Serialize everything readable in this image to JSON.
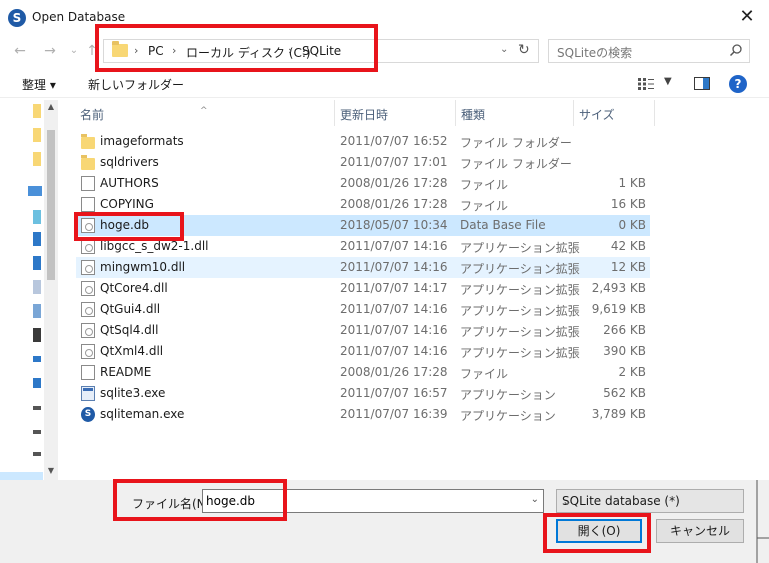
{
  "window": {
    "title": "Open Database",
    "app_icon_letter": "S",
    "close_glyph": "✕"
  },
  "address_bar": {
    "crumbs": [
      "PC",
      "ローカル ディスク (C:)",
      "SQLite"
    ],
    "separator": "›"
  },
  "search": {
    "placeholder": "SQLiteの検索",
    "icon": "search-icon"
  },
  "toolbar": {
    "organize_label": "整理 ▾",
    "new_folder_label": "新しいフォルダー"
  },
  "columns": {
    "name": "名前",
    "date": "更新日時",
    "type": "種類",
    "size": "サイズ"
  },
  "files": [
    {
      "name": "imageformats",
      "date": "2011/07/07 16:52",
      "type": "ファイル フォルダー",
      "size": "",
      "icon": "folder-icon"
    },
    {
      "name": "sqldrivers",
      "date": "2011/07/07 17:01",
      "type": "ファイル フォルダー",
      "size": "",
      "icon": "folder-icon"
    },
    {
      "name": "AUTHORS",
      "date": "2008/01/26 17:28",
      "type": "ファイル",
      "size": "1 KB",
      "icon": "file-icon"
    },
    {
      "name": "COPYING",
      "date": "2008/01/26 17:28",
      "type": "ファイル",
      "size": "16 KB",
      "icon": "file-icon"
    },
    {
      "name": "hoge.db",
      "date": "2018/05/07 10:34",
      "type": "Data Base File",
      "size": "0 KB",
      "icon": "db-file-icon",
      "state": "selected"
    },
    {
      "name": "libgcc_s_dw2-1.dll",
      "date": "2011/07/07 14:16",
      "type": "アプリケーション拡張",
      "size": "42 KB",
      "icon": "dll-icon"
    },
    {
      "name": "mingwm10.dll",
      "date": "2011/07/07 14:16",
      "type": "アプリケーション拡張",
      "size": "12 KB",
      "icon": "dll-icon",
      "state": "hover"
    },
    {
      "name": "QtCore4.dll",
      "date": "2011/07/07 14:17",
      "type": "アプリケーション拡張",
      "size": "2,493 KB",
      "icon": "dll-icon"
    },
    {
      "name": "QtGui4.dll",
      "date": "2011/07/07 14:16",
      "type": "アプリケーション拡張",
      "size": "9,619 KB",
      "icon": "dll-icon"
    },
    {
      "name": "QtSql4.dll",
      "date": "2011/07/07 14:16",
      "type": "アプリケーション拡張",
      "size": "266 KB",
      "icon": "dll-icon"
    },
    {
      "name": "QtXml4.dll",
      "date": "2011/07/07 14:16",
      "type": "アプリケーション拡張",
      "size": "390 KB",
      "icon": "dll-icon"
    },
    {
      "name": "README",
      "date": "2008/01/26 17:28",
      "type": "ファイル",
      "size": "2 KB",
      "icon": "file-icon"
    },
    {
      "name": "sqlite3.exe",
      "date": "2011/07/07 16:57",
      "type": "アプリケーション",
      "size": "562 KB",
      "icon": "exe-icon"
    },
    {
      "name": "sqliteman.exe",
      "date": "2011/07/07 16:39",
      "type": "アプリケーション",
      "size": "3,789 KB",
      "icon": "app-icon"
    }
  ],
  "footer": {
    "filename_label": "ファイル名(N):",
    "filename_value": "hoge.db",
    "filetype_value": "SQLite database (*)",
    "open_label": "開く(O)",
    "cancel_label": "キャンセル"
  },
  "colors": {
    "highlight_red": "#e8141b",
    "selection_blue": "#cce8ff",
    "hover_blue": "#e5f3ff",
    "folder_yellow": "#f8d775"
  }
}
